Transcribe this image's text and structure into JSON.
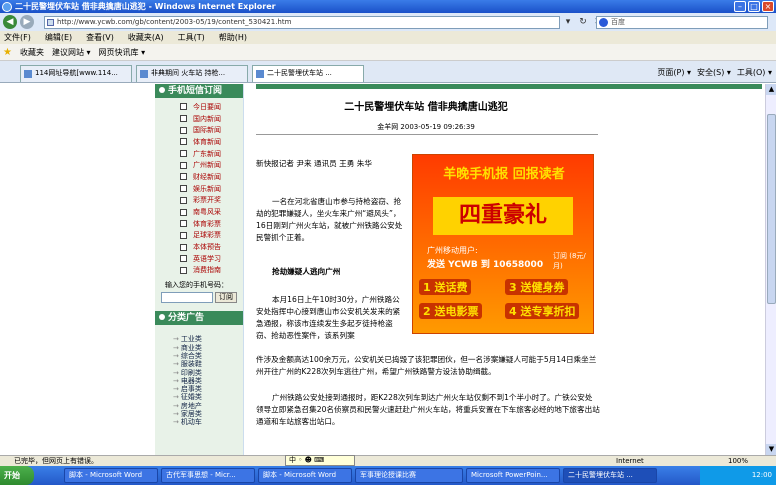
{
  "window": {
    "title": "二十民警埋伏车站  借非典擒唐山逃犯 - Windows Internet Explorer"
  },
  "address": {
    "url": "http://www.ycwb.com/gb/content/2003-05/19/content_530421.htm",
    "search_placeholder": "百度"
  },
  "menu": [
    "文件(F)",
    "编辑(E)",
    "查看(V)",
    "收藏夹(A)",
    "工具(T)",
    "帮助(H)"
  ],
  "favorites": {
    "label": "收藏夹",
    "items": [
      "建议网站 ▾",
      "网页快讯库 ▾"
    ]
  },
  "tabs": [
    {
      "label": "114网址导航[www.114..."
    },
    {
      "label": "非典期间 火车站 持枪..."
    },
    {
      "label": "二十民警埋伏车站 ..."
    }
  ],
  "right_tools": [
    "页面(P) ▾",
    "安全(S) ▾",
    "工具(O) ▾"
  ],
  "sidebar": {
    "sms_title": "手机短信订阅",
    "sms_items": [
      "今日要闻",
      "国内新闻",
      "国际新闻",
      "体育新闻",
      "广东新闻",
      "广州新闻",
      "财经新闻",
      "娱乐新闻",
      "彩票开奖",
      "南粤风采",
      "体育彩票",
      "足球彩票",
      "本体预告",
      "英语学习",
      "消费指南"
    ],
    "phone_label": "输入您的手机号码：",
    "subscribe_label": "订阅",
    "category_title": "分类广告",
    "categories": [
      "工业类",
      "商业类",
      "综合类",
      "服装鞋",
      "印刷类",
      "电器类",
      "启事类",
      "征婚类",
      "房地产",
      "家居类",
      "机动车"
    ]
  },
  "article": {
    "title": "二十民警埋伏车站  借非典擒唐山逃犯",
    "meta": "金羊网 2003-05-19 09:26:39",
    "byline": "新快报记者  尹来  通讯员  王勇  朱华",
    "p1": "一名在河北省唐山市参与持枪盗窃、抢劫的犯罪嫌疑人，坐火车来广州“避风头”，16日刚到广州火车站，就被广州铁路公安处民警抓个正着。",
    "subhead": "抢劫嫌疑人逃向广州",
    "p2a": "本月16日上午10时30分，广州铁路公安处指挥中心接到唐山市公安机关发来的紧急通报，称该市连续发生多起歹徒持枪盗窃、抢劫恶性案件，该系列案",
    "p2b": "件涉及金额高达100余万元，公安机关已捣毁了该犯罪团伙，但一名涉案嫌疑人可能于5月14日乘坐兰州开往广州的K228次列车逃往广州，希望广州铁路警方设法协助缉截。",
    "p3": "广州铁路公安处接到通报时，距K228次列车到达广州火车站仅剩不到1个半小时了。广铁公安处领导立即紧急召集20名侦察员和民警火速赶赴广州火车站，将重兵安置在下车旅客必经的地下旅客出站通道和车站旅客出站口。"
  },
  "ad": {
    "headline": "羊晚手机报 回报读者",
    "big": "四重豪礼",
    "mobile": "广州移动用户:",
    "send": "发送 YCWB 到 10658000",
    "price": "订阅 (8元/月)",
    "opt1": "1 送话费",
    "opt2": "3 送健身券",
    "opt3": "2 送电影票",
    "opt4": "4 送专享折扣"
  },
  "ime": "中 ◦ ☻ ⌨",
  "status": {
    "text": "已完毕，但网页上有错误。",
    "zone": "Internet",
    "zoom": "100%"
  },
  "taskbar": {
    "start": "开始",
    "tasks": [
      "脚本 - Microsoft Word",
      "古代军事思想 - Micr...",
      "脚本 - Microsoft Word",
      "军事理论授课比赛",
      "Microsoft PowerPoin...",
      "二十民警埋伏车站 ..."
    ],
    "clock": "12:00"
  }
}
